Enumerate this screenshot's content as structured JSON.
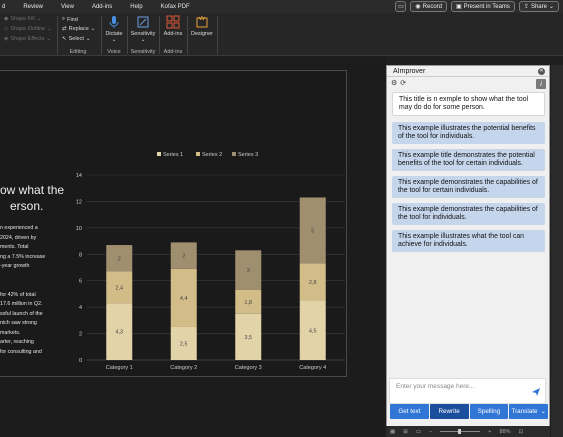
{
  "menubar": {
    "items": [
      "d",
      "Review",
      "View",
      "Add-ins",
      "Help",
      "Kofax PDF"
    ],
    "record": "Record",
    "present": "Present in Teams",
    "share": "Share"
  },
  "ribbon": {
    "shape_fill": "Shape Fill",
    "shape_outline": "Shape Outline",
    "shape_effects": "Shape Effects",
    "find": "Find",
    "replace": "Replace",
    "select": "Select",
    "editing_label": "Editing",
    "dictate": "Dictate",
    "voice_label": "Voice",
    "sensitivity": "Sensitivity",
    "sensitivity_label": "Sensitivity",
    "addins": "Add-ins",
    "addins_label": "Add-ins",
    "designer": "Designer"
  },
  "slide": {
    "title_lines": [
      "ow what the",
      "erson."
    ],
    "body_lines": [
      "n experienced a",
      " 2024, driven by",
      "ments. Total",
      "ng a 7.5% increase",
      "-year growth",
      "",
      "",
      "for 42% of total",
      "17.6 million in Q2.",
      "ssful launch of the",
      "nich saw strong",
      "markets.",
      "arter, reaching",
      "for consulting and"
    ]
  },
  "chart_data": {
    "type": "bar",
    "stacked": true,
    "categories": [
      "Category 1",
      "Category 2",
      "Category 3",
      "Category 4"
    ],
    "series": [
      {
        "name": "Series 1",
        "values": [
          4.3,
          2.5,
          3.5,
          4.5
        ],
        "color": "#e3d3a8"
      },
      {
        "name": "Series 2",
        "values": [
          2.4,
          4.4,
          1.8,
          2.8
        ],
        "color": "#d2bd89"
      },
      {
        "name": "Series 3",
        "values": [
          2,
          2,
          3,
          5
        ],
        "color": "#9f8f6e"
      }
    ],
    "data_labels": [
      [
        "4,3",
        "2,4",
        "2"
      ],
      [
        "2,5",
        "4,4",
        "2"
      ],
      [
        "3,5",
        "1,8",
        "3"
      ],
      [
        "4,5",
        "2,8",
        "5"
      ]
    ],
    "ylim": [
      0,
      14
    ],
    "yticks": [
      0,
      2,
      4,
      6,
      8,
      10,
      12,
      14
    ],
    "grid": true,
    "legend": "top"
  },
  "pane": {
    "title": "AImprover",
    "info": "i",
    "source_text": "This title is n exmple to show what the tool may do do for some person.",
    "suggestions": [
      "This example illustrates the potential benefits of the tool for individuals.",
      "This example title demonstrates the potential benefits of the tool for certain individuals.",
      "This example demonstrates the capabilities of the tool for certain individuals.",
      "This example demonstrates the capabilities of the tool for individuals.",
      "This example illustrates what the tool can achieve for individuals."
    ],
    "input_placeholder": "Enter your message here...",
    "buttons": [
      "Get text",
      "Rewrite",
      "Spelling",
      "Translate"
    ]
  },
  "statusbar": {
    "zoom": "88%"
  }
}
